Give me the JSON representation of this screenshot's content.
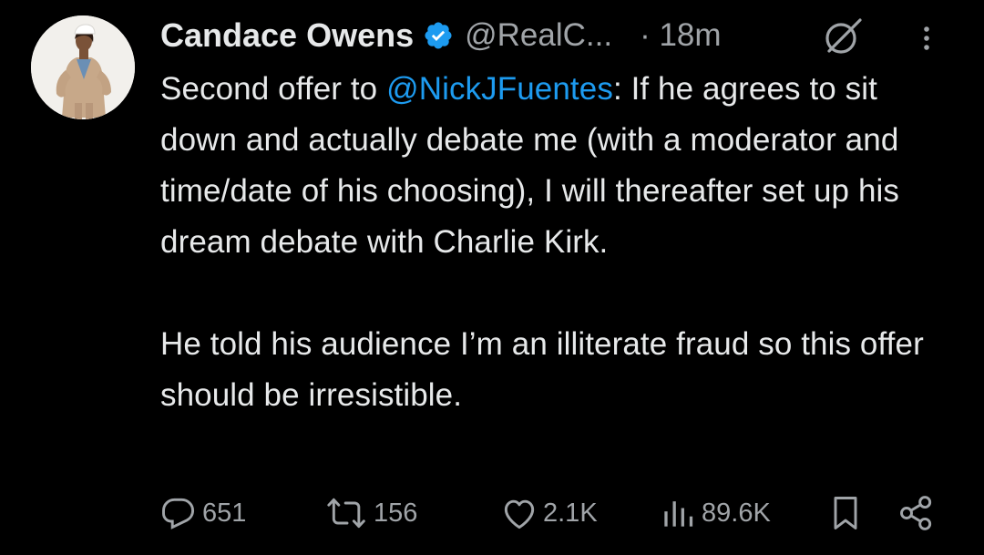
{
  "author": {
    "name": "Candace Owens",
    "handle": "@RealC...",
    "time": "· 18m",
    "verified": true
  },
  "tweet": {
    "line1_pre": "Second offer to ",
    "mention": "@NickJFuentes",
    "line1_post": ": If he agrees to sit down and actually debate me (with a moderator and time/date of his choosing), I will thereafter set up his dream debate with Charlie Kirk.",
    "paragraph2": "He told his audience I’m an illiterate fraud so this offer should be irresistible."
  },
  "stats": {
    "replies": "651",
    "reposts": "156",
    "likes": "2.1K",
    "views": "89.6K"
  },
  "icons": {
    "verified": "verified-badge-icon",
    "grok": "grok-icon",
    "more": "more-vertical-icon",
    "reply": "reply-icon",
    "repost": "repost-icon",
    "like": "heart-icon",
    "views": "views-icon",
    "bookmark": "bookmark-icon",
    "share": "share-icon"
  },
  "colors": {
    "background": "#000000",
    "text": "#e7e9ea",
    "muted": "#a0a4a8",
    "accent": "#1d9bf0"
  }
}
